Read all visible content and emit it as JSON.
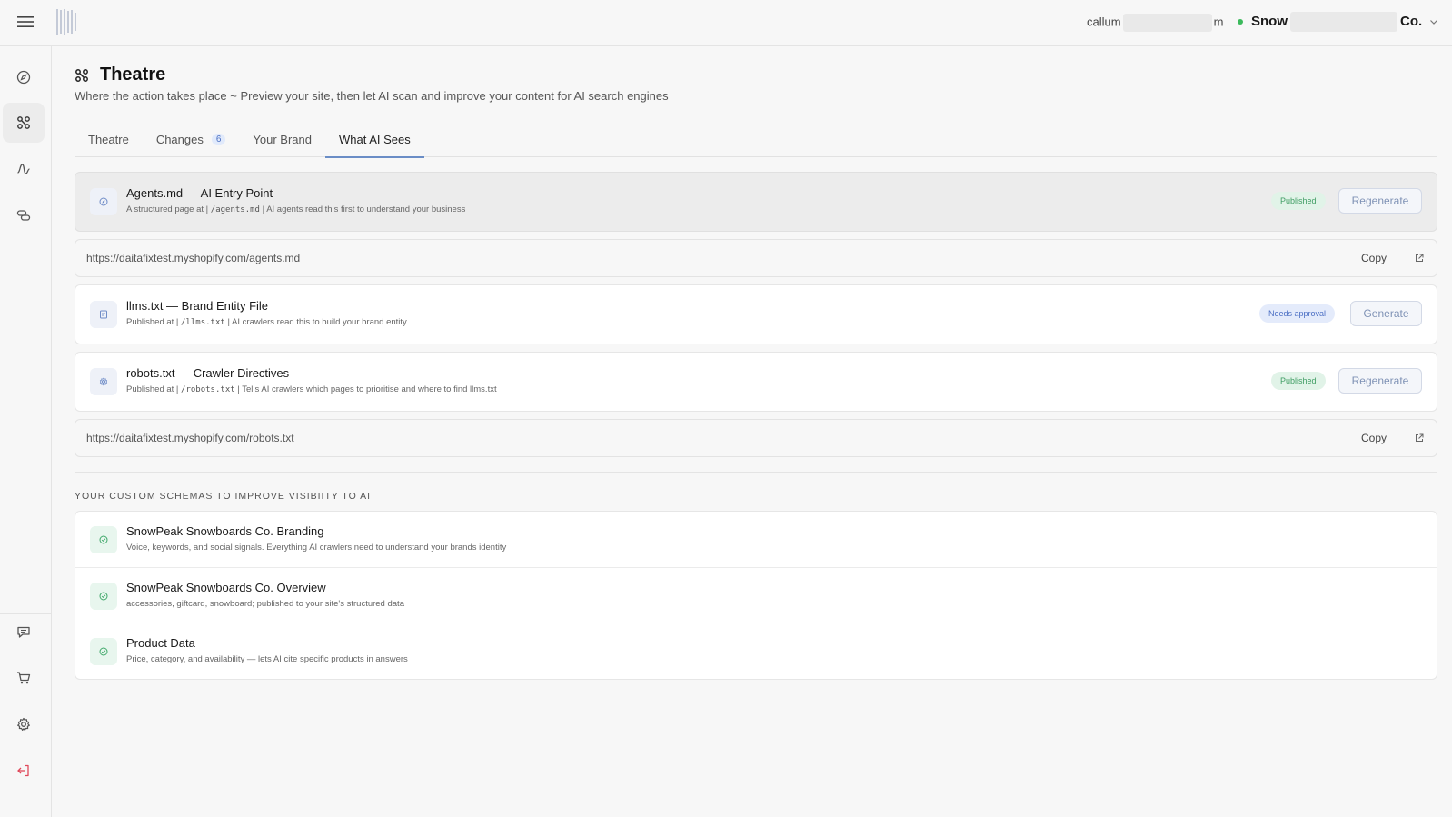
{
  "header": {
    "user_email_prefix": "callum",
    "user_email_suffix": "m",
    "store_name_prefix": "Snow",
    "store_name_suffix": "Co.",
    "store_status_color": "#3cba5c"
  },
  "sidebar": {
    "items": [
      {
        "name": "compass-icon",
        "active": false
      },
      {
        "name": "theatre-icon",
        "active": true
      },
      {
        "name": "activity-icon",
        "active": false
      },
      {
        "name": "links-icon",
        "active": false
      },
      {
        "name": "chat-icon",
        "active": false
      },
      {
        "name": "cart-icon",
        "active": false
      },
      {
        "name": "gear-icon",
        "active": false
      },
      {
        "name": "logout-icon",
        "active": false
      }
    ]
  },
  "page": {
    "title": "Theatre",
    "subtitle": "Where the action takes place ~ Preview your site, then let AI scan and improve your content for AI search engines"
  },
  "tabs": [
    {
      "label": "Theatre"
    },
    {
      "label": "Changes",
      "badge": "6"
    },
    {
      "label": "Your Brand"
    },
    {
      "label": "What AI Sees",
      "active": true
    }
  ],
  "files": {
    "agents": {
      "title": "Agents.md — AI Entry Point",
      "desc_prefix": "A structured page at |",
      "desc_path": "/agents.md",
      "desc_suffix": "| AI agents read this first to understand your business",
      "status": "Published",
      "action": "Regenerate",
      "url": "https://daitafixtest.myshopify.com/agents.md",
      "copy_label": "Copy"
    },
    "llms": {
      "title": "llms.txt — Brand Entity File",
      "desc_prefix": "Published at |",
      "desc_path": "/llms.txt",
      "desc_suffix": "| AI crawlers read this to build your brand entity",
      "status": "Needs approval",
      "action": "Generate"
    },
    "robots": {
      "title": "robots.txt — Crawler Directives",
      "desc_prefix": "Published at |",
      "desc_path": "/robots.txt",
      "desc_suffix": "| Tells AI crawlers which pages to prioritise and where to find llms.txt",
      "status": "Published",
      "action": "Regenerate",
      "url": "https://daitafixtest.myshopify.com/robots.txt",
      "copy_label": "Copy"
    }
  },
  "schemas": {
    "heading": "YOUR CUSTOM SCHEMAS TO IMPROVE VISIBIITY TO AI",
    "items": [
      {
        "title": "SnowPeak Snowboards Co. Branding",
        "desc": "Voice, keywords, and social signals. Everything AI crawlers need to understand your brands identity"
      },
      {
        "title": "SnowPeak Snowboards Co. Overview",
        "desc": "accessories, giftcard, snowboard; published to your site's structured data"
      },
      {
        "title": "Product Data",
        "desc": "Price, category, and availability — lets AI cite specific products in answers"
      }
    ]
  }
}
